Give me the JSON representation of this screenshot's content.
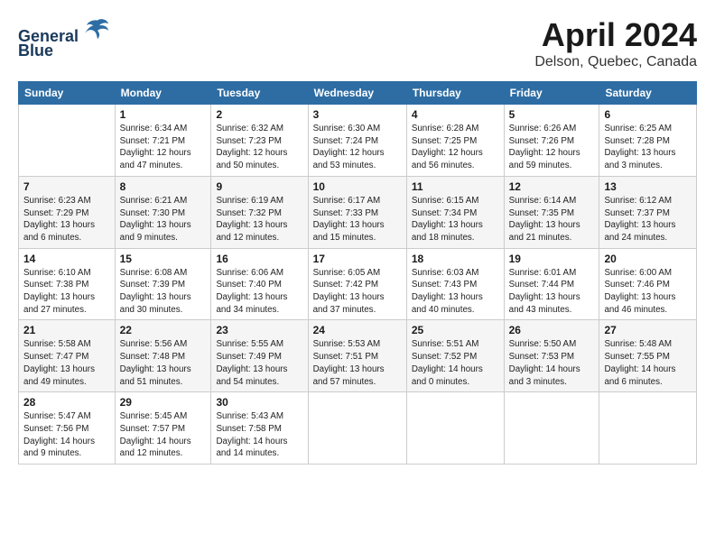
{
  "header": {
    "logo_line1": "General",
    "logo_line2": "Blue",
    "title": "April 2024",
    "subtitle": "Delson, Quebec, Canada"
  },
  "calendar": {
    "weekdays": [
      "Sunday",
      "Monday",
      "Tuesday",
      "Wednesday",
      "Thursday",
      "Friday",
      "Saturday"
    ],
    "weeks": [
      [
        {
          "day": "",
          "info": ""
        },
        {
          "day": "1",
          "info": "Sunrise: 6:34 AM\nSunset: 7:21 PM\nDaylight: 12 hours\nand 47 minutes."
        },
        {
          "day": "2",
          "info": "Sunrise: 6:32 AM\nSunset: 7:23 PM\nDaylight: 12 hours\nand 50 minutes."
        },
        {
          "day": "3",
          "info": "Sunrise: 6:30 AM\nSunset: 7:24 PM\nDaylight: 12 hours\nand 53 minutes."
        },
        {
          "day": "4",
          "info": "Sunrise: 6:28 AM\nSunset: 7:25 PM\nDaylight: 12 hours\nand 56 minutes."
        },
        {
          "day": "5",
          "info": "Sunrise: 6:26 AM\nSunset: 7:26 PM\nDaylight: 12 hours\nand 59 minutes."
        },
        {
          "day": "6",
          "info": "Sunrise: 6:25 AM\nSunset: 7:28 PM\nDaylight: 13 hours\nand 3 minutes."
        }
      ],
      [
        {
          "day": "7",
          "info": "Sunrise: 6:23 AM\nSunset: 7:29 PM\nDaylight: 13 hours\nand 6 minutes."
        },
        {
          "day": "8",
          "info": "Sunrise: 6:21 AM\nSunset: 7:30 PM\nDaylight: 13 hours\nand 9 minutes."
        },
        {
          "day": "9",
          "info": "Sunrise: 6:19 AM\nSunset: 7:32 PM\nDaylight: 13 hours\nand 12 minutes."
        },
        {
          "day": "10",
          "info": "Sunrise: 6:17 AM\nSunset: 7:33 PM\nDaylight: 13 hours\nand 15 minutes."
        },
        {
          "day": "11",
          "info": "Sunrise: 6:15 AM\nSunset: 7:34 PM\nDaylight: 13 hours\nand 18 minutes."
        },
        {
          "day": "12",
          "info": "Sunrise: 6:14 AM\nSunset: 7:35 PM\nDaylight: 13 hours\nand 21 minutes."
        },
        {
          "day": "13",
          "info": "Sunrise: 6:12 AM\nSunset: 7:37 PM\nDaylight: 13 hours\nand 24 minutes."
        }
      ],
      [
        {
          "day": "14",
          "info": "Sunrise: 6:10 AM\nSunset: 7:38 PM\nDaylight: 13 hours\nand 27 minutes."
        },
        {
          "day": "15",
          "info": "Sunrise: 6:08 AM\nSunset: 7:39 PM\nDaylight: 13 hours\nand 30 minutes."
        },
        {
          "day": "16",
          "info": "Sunrise: 6:06 AM\nSunset: 7:40 PM\nDaylight: 13 hours\nand 34 minutes."
        },
        {
          "day": "17",
          "info": "Sunrise: 6:05 AM\nSunset: 7:42 PM\nDaylight: 13 hours\nand 37 minutes."
        },
        {
          "day": "18",
          "info": "Sunrise: 6:03 AM\nSunset: 7:43 PM\nDaylight: 13 hours\nand 40 minutes."
        },
        {
          "day": "19",
          "info": "Sunrise: 6:01 AM\nSunset: 7:44 PM\nDaylight: 13 hours\nand 43 minutes."
        },
        {
          "day": "20",
          "info": "Sunrise: 6:00 AM\nSunset: 7:46 PM\nDaylight: 13 hours\nand 46 minutes."
        }
      ],
      [
        {
          "day": "21",
          "info": "Sunrise: 5:58 AM\nSunset: 7:47 PM\nDaylight: 13 hours\nand 49 minutes."
        },
        {
          "day": "22",
          "info": "Sunrise: 5:56 AM\nSunset: 7:48 PM\nDaylight: 13 hours\nand 51 minutes."
        },
        {
          "day": "23",
          "info": "Sunrise: 5:55 AM\nSunset: 7:49 PM\nDaylight: 13 hours\nand 54 minutes."
        },
        {
          "day": "24",
          "info": "Sunrise: 5:53 AM\nSunset: 7:51 PM\nDaylight: 13 hours\nand 57 minutes."
        },
        {
          "day": "25",
          "info": "Sunrise: 5:51 AM\nSunset: 7:52 PM\nDaylight: 14 hours\nand 0 minutes."
        },
        {
          "day": "26",
          "info": "Sunrise: 5:50 AM\nSunset: 7:53 PM\nDaylight: 14 hours\nand 3 minutes."
        },
        {
          "day": "27",
          "info": "Sunrise: 5:48 AM\nSunset: 7:55 PM\nDaylight: 14 hours\nand 6 minutes."
        }
      ],
      [
        {
          "day": "28",
          "info": "Sunrise: 5:47 AM\nSunset: 7:56 PM\nDaylight: 14 hours\nand 9 minutes."
        },
        {
          "day": "29",
          "info": "Sunrise: 5:45 AM\nSunset: 7:57 PM\nDaylight: 14 hours\nand 12 minutes."
        },
        {
          "day": "30",
          "info": "Sunrise: 5:43 AM\nSunset: 7:58 PM\nDaylight: 14 hours\nand 14 minutes."
        },
        {
          "day": "",
          "info": ""
        },
        {
          "day": "",
          "info": ""
        },
        {
          "day": "",
          "info": ""
        },
        {
          "day": "",
          "info": ""
        }
      ]
    ]
  }
}
